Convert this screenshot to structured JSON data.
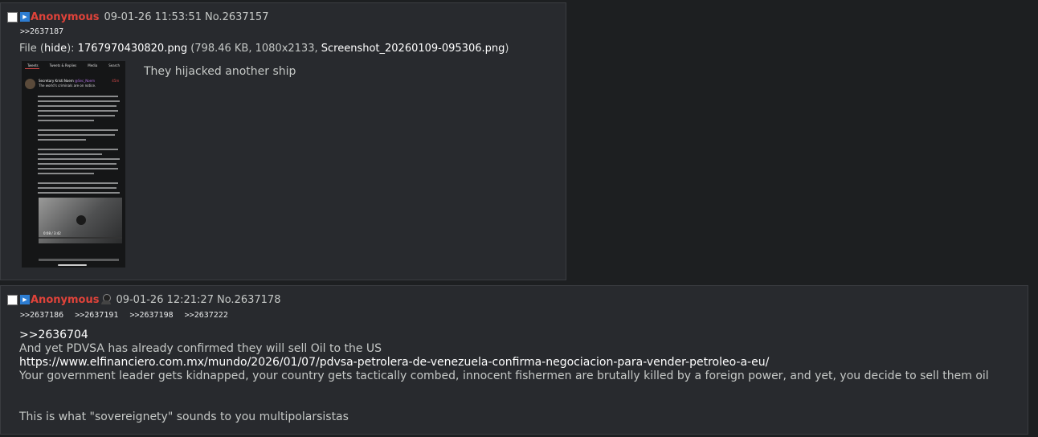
{
  "posts": [
    {
      "name": "Anonymous",
      "flag_icon": "flag-icon",
      "datetime": "09-01-26 11:53:51",
      "number": "No.2637157",
      "replies": [
        ">>2637187"
      ],
      "file": {
        "label": "File (",
        "hide": "hide",
        "sep": "): ",
        "filename": "1767970430820.png",
        "meta": " (798.46 KB, 1080x2133, ",
        "original": "Screenshot_20260109-095306.png",
        "close": ")"
      },
      "thumbnail": {
        "tabs": [
          "Tweets",
          "Tweets & Replies",
          "Media",
          "Search"
        ],
        "author": "Secretary Kristi Noem",
        "handle": "@Sec_Noem",
        "time": "45m",
        "first_line": "The world's criminals are on notice.",
        "video_time": "0:08 / 3:42"
      },
      "comment": "They hijacked another ship"
    },
    {
      "name": "Anonymous",
      "flag_icon": "flag-icon",
      "poster_icon": "poster-avatar-icon",
      "datetime": "09-01-26 12:21:27",
      "number": "No.2637178",
      "replies": [
        ">>2637186",
        ">>2637191",
        ">>2637198",
        ">>2637222"
      ],
      "comment_lines": {
        "quote": ">>2636704",
        "line1": "And yet PDVSA has already confirmed they will sell Oil to the US",
        "url": "https://www.elfinanciero.com.mx/mundo/2026/01/07/pdvsa-petrolera-de-venezuela-confirma-negociacion-para-vender-petroleo-a-eu/",
        "line2": "Your government leader gets kidnapped, your country gets tactically combed, innocent fishermen are brutally killed by a foreign power, and yet, you decide to sell them oil",
        "line3": "This is what \"sovereignety\" sounds to you multipolarsistas"
      }
    }
  ],
  "colors": {
    "background": "#1d1f21",
    "post_background": "#282a2e",
    "name": "#e0433a",
    "text": "#c5c8c6",
    "link": "#ffffff"
  }
}
